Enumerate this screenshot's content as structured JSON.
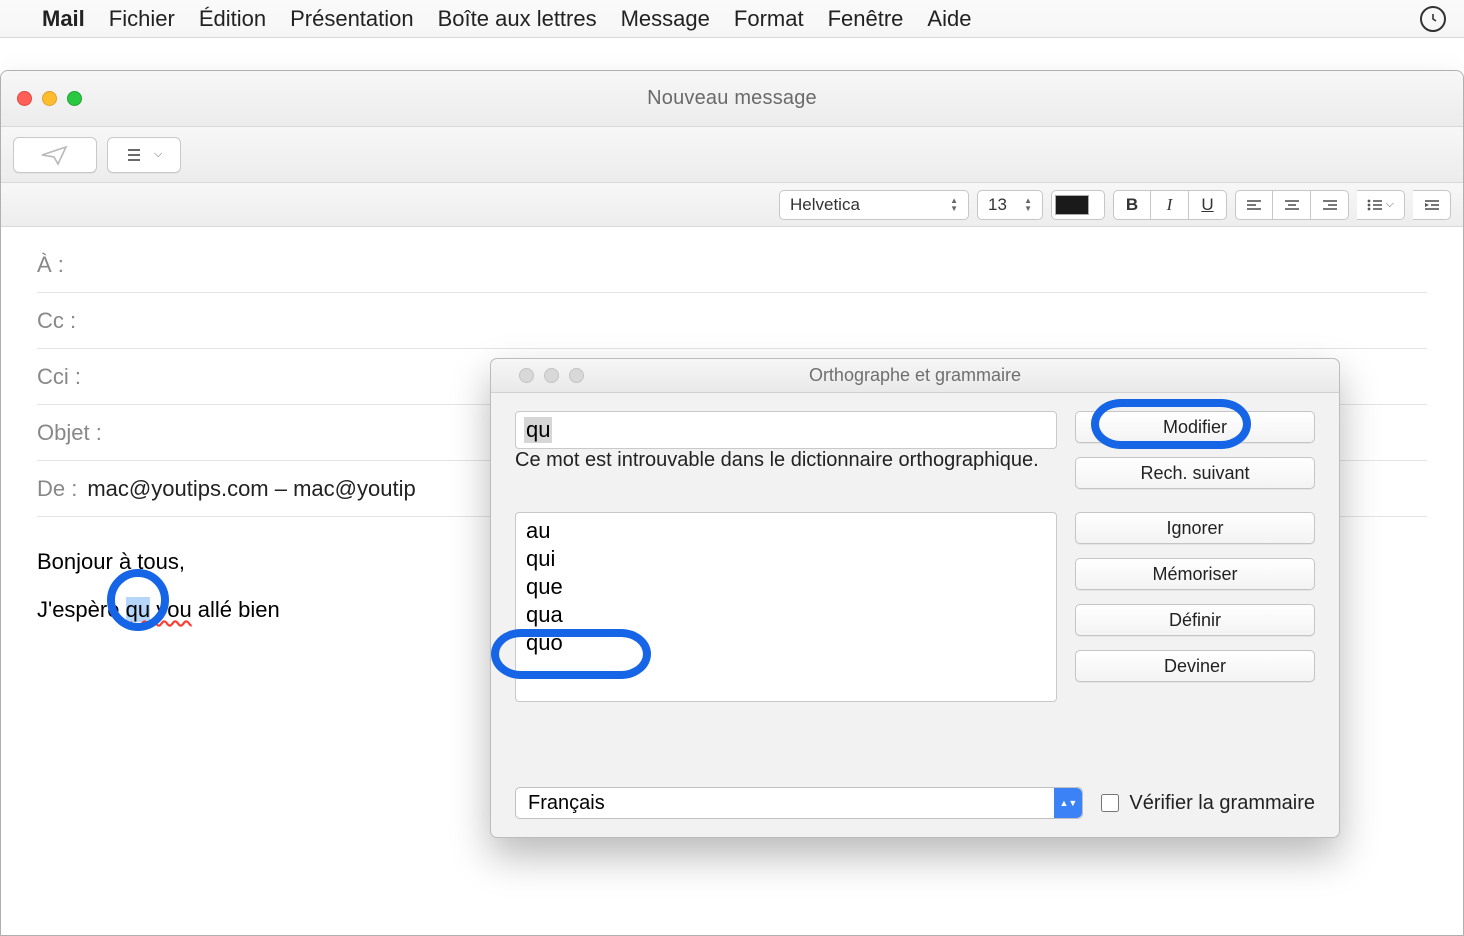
{
  "menubar": {
    "app": "Mail",
    "items": [
      "Fichier",
      "Édition",
      "Présentation",
      "Boîte aux lettres",
      "Message",
      "Format",
      "Fenêtre",
      "Aide"
    ]
  },
  "window": {
    "title": "Nouveau message"
  },
  "format": {
    "font": "Helvetica",
    "size": "13",
    "bold": "B",
    "italic": "I",
    "underline": "U"
  },
  "fields": {
    "to_label": "À :",
    "cc_label": "Cc :",
    "bcc_label": "Cci :",
    "subject_label": "Objet :",
    "from_label": "De :",
    "from_value": "mac@youtips.com – mac@youtip"
  },
  "body": {
    "line1": "Bonjour à tous,",
    "line2_a": "J'espère ",
    "line2_sel": "qu",
    "line2_b": " ",
    "line2_typo": "vou",
    "line2_c": " allé bien"
  },
  "spell": {
    "title": "Orthographe et grammaire",
    "word": "qu",
    "message": "Ce mot est introuvable dans le dictionnaire orthographique.",
    "suggestions": [
      "au",
      "qui",
      "que",
      "qua",
      "quo"
    ],
    "buttons": {
      "modify": "Modifier",
      "find_next": "Rech. suivant",
      "ignore": "Ignorer",
      "learn": "Mémoriser",
      "define": "Définir",
      "guess": "Deviner"
    },
    "language": "Français",
    "check_grammar_label": "Vérifier la grammaire"
  }
}
